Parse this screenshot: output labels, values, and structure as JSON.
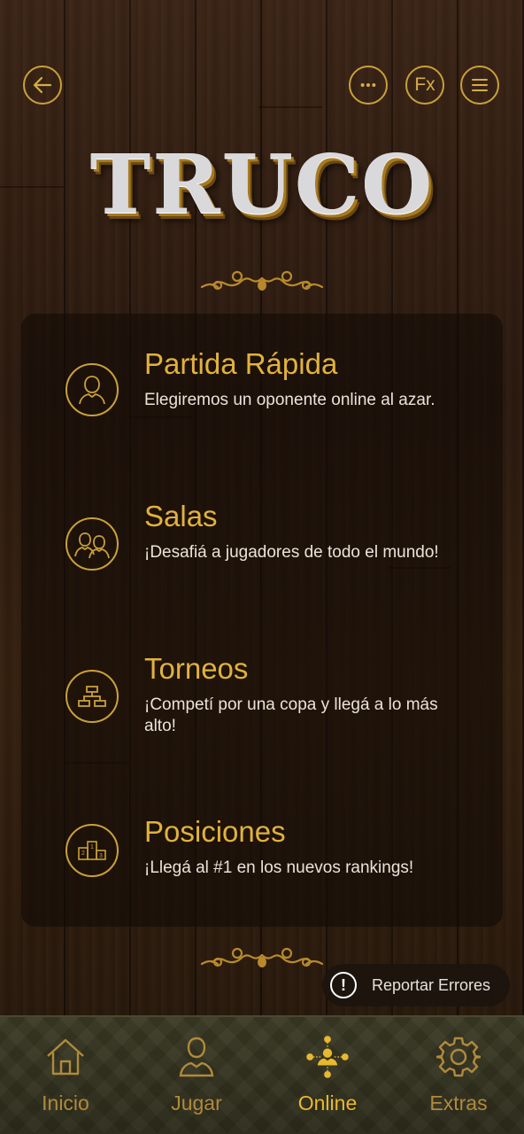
{
  "header": {
    "back_icon": "arrow-left-icon",
    "chat_icon": "chat-bubble-icon",
    "fx_label": "Fx",
    "menu_icon": "hamburger-menu-icon"
  },
  "logo": {
    "text": "TRUCO"
  },
  "menu": {
    "items": [
      {
        "title": "Partida Rápida",
        "description": "Elegiremos un oponente online al azar.",
        "icon": "user-icon"
      },
      {
        "title": "Salas",
        "description": "¡Desafiá a jugadores de todo el mundo!",
        "icon": "users-icon"
      },
      {
        "title": "Torneos",
        "description": "¡Competí por una copa y llegá a lo más alto!",
        "icon": "bracket-icon"
      },
      {
        "title": "Posiciones",
        "description": "¡Llegá al #1 en los nuevos rankings!",
        "icon": "podium-icon"
      }
    ]
  },
  "report": {
    "label": "Reportar Errores",
    "icon": "exclamation-icon"
  },
  "nav": {
    "items": [
      {
        "label": "Inicio",
        "icon": "home-icon"
      },
      {
        "label": "Jugar",
        "icon": "person-icon"
      },
      {
        "label": "Online",
        "icon": "network-icon",
        "active": true
      },
      {
        "label": "Extras",
        "icon": "gear-icon"
      }
    ]
  },
  "colors": {
    "accent": "#e1b23c",
    "gold_outline": "#c9a03a",
    "text_light": "#ece3d6",
    "active_nav": "#e8b92e",
    "inactive_nav": "#b08a3c"
  }
}
